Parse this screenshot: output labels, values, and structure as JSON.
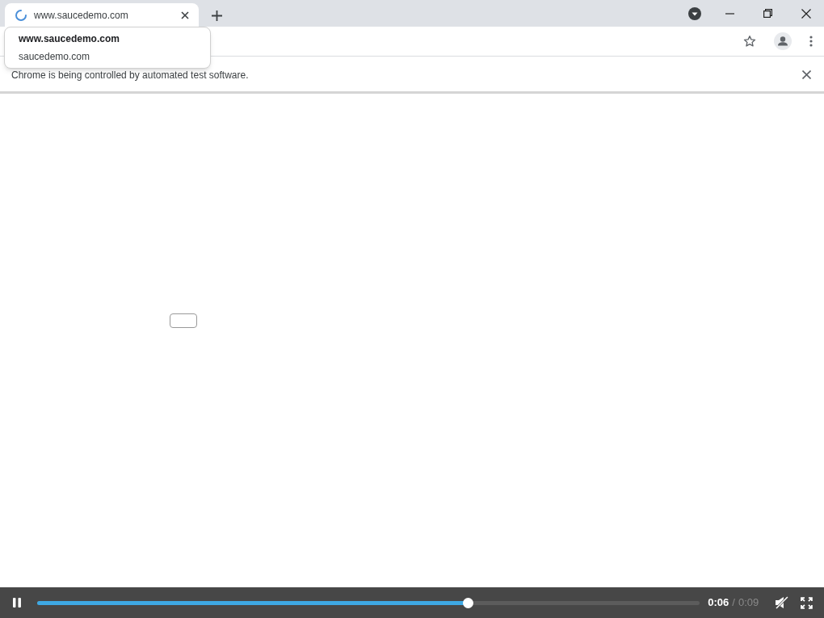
{
  "tab": {
    "title": "www.saucedemo.com",
    "loading": true
  },
  "tab_hover_card": {
    "title": "www.saucedemo.com",
    "domain": "saucedemo.com"
  },
  "infobar": {
    "text": "Chrome is being controlled by automated test software."
  },
  "video_controls": {
    "playing": true,
    "level": 0.65,
    "current_time": "0:06",
    "separator": "/",
    "duration": "0:09",
    "muted": true
  }
}
